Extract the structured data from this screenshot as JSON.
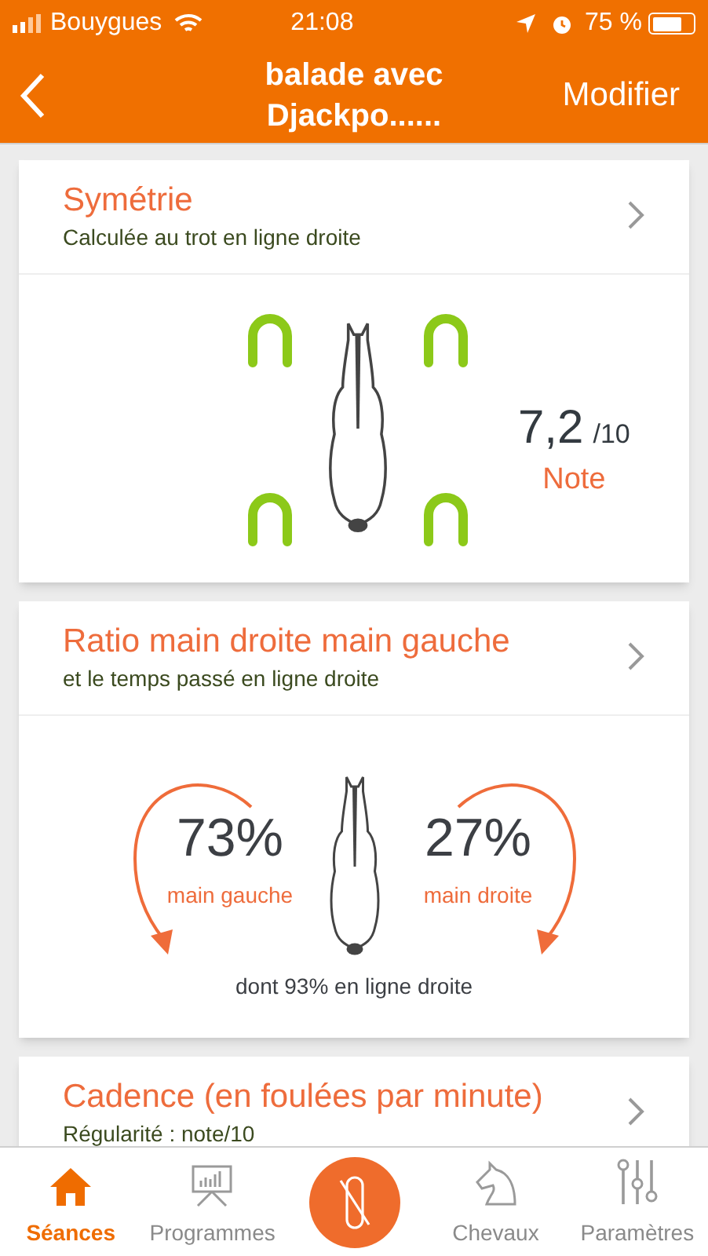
{
  "status_bar": {
    "carrier": "Bouygues",
    "time": "21:08",
    "battery": "75 %"
  },
  "nav": {
    "title": "balade avec Djackpo......",
    "action": "Modifier"
  },
  "cards": [
    {
      "kind": "symmetry",
      "title": "Symétrie",
      "subtitle": "Calculée au trot en ligne droite",
      "score": "7,2",
      "scale": "/10",
      "score_label": "Note"
    },
    {
      "kind": "ratio",
      "title": "Ratio main droite main gauche",
      "subtitle": "et le temps passé en ligne droite",
      "left_value": "73%",
      "left_label": "main gauche",
      "right_value": "27%",
      "right_label": "main droite",
      "footer": "dont 93% en ligne droite"
    },
    {
      "kind": "cadence",
      "title": "Cadence (en foulées par minute)",
      "subtitle": "Régularité : note/10"
    }
  ],
  "tabs": [
    {
      "kind": "home",
      "label": "Séances",
      "selected": true
    },
    {
      "kind": "programs",
      "label": "Programmes",
      "selected": false
    },
    {
      "kind": "record",
      "selected": false
    },
    {
      "kind": "horses",
      "label": "Chevaux",
      "selected": false
    },
    {
      "kind": "settings",
      "label": "Paramètres",
      "selected": false
    }
  ]
}
